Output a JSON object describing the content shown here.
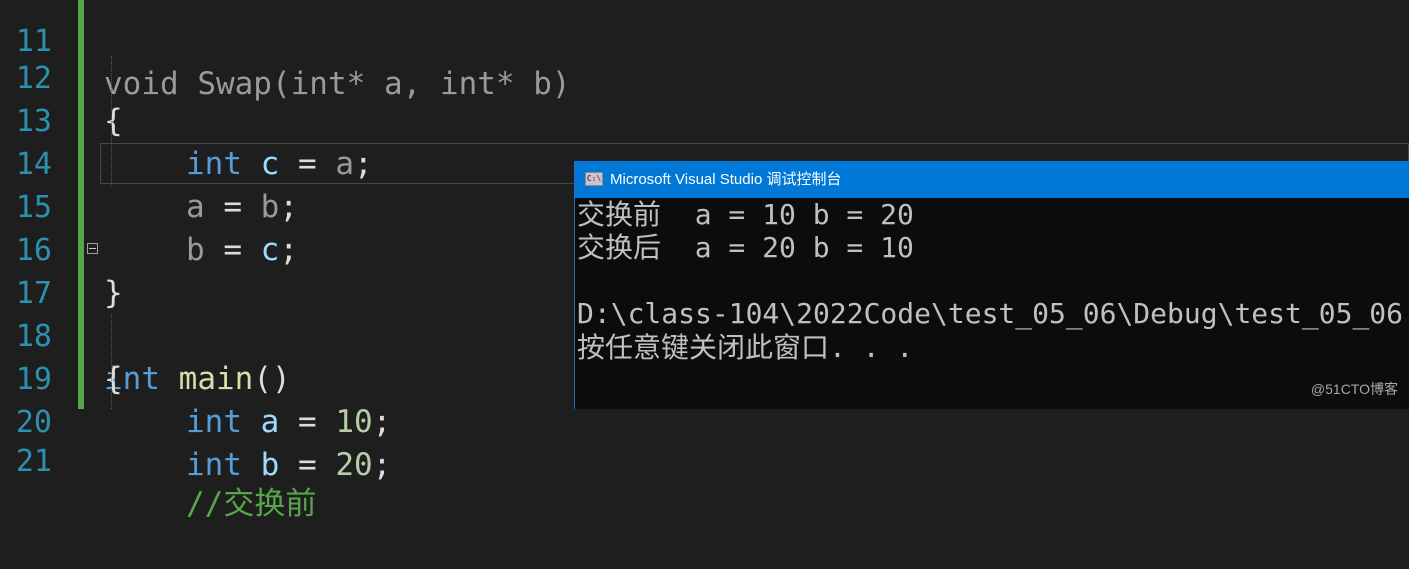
{
  "editor": {
    "lines": [
      {
        "number": "11",
        "text": "void Swap(int* a, int* b)"
      },
      {
        "number": "12",
        "text": "{"
      },
      {
        "number": "13",
        "kw": "int",
        "var": "c",
        "op": " = ",
        "param": "a",
        "end": ";"
      },
      {
        "number": "14",
        "param1": "a",
        "op": " = ",
        "param2": "b",
        "end": ";"
      },
      {
        "number": "15",
        "param1": "b",
        "op": " = ",
        "var": "c",
        "end": ";"
      },
      {
        "number": "16",
        "text": "}"
      },
      {
        "number": "17",
        "kw": "int",
        "fn": "main",
        "end": "()"
      },
      {
        "number": "18",
        "text": "{"
      },
      {
        "number": "19",
        "kw": "int",
        "var": "a",
        "op": " = ",
        "num": "10",
        "end": ";"
      },
      {
        "number": "20",
        "kw": "int",
        "var": "b",
        "op": " = ",
        "num": "20",
        "end": ";"
      },
      {
        "number": "21",
        "text": "//交换前"
      }
    ]
  },
  "console": {
    "title": "Microsoft Visual Studio 调试控制台",
    "icon_label": "C:\\",
    "lines": [
      "交换前  a = 10 b = 20",
      "交换后  a = 20 b = 10",
      "",
      "D:\\class-104\\2022Code\\test_05_06\\Debug\\test_05_06",
      "按任意键关闭此窗口. . ."
    ]
  },
  "watermark": "@51CTO博客",
  "colors": {
    "editor_bg": "#1e1e1e",
    "line_number": "#2b91af",
    "keyword": "#569cd6",
    "variable": "#9cdcfe",
    "number": "#b5cea8",
    "function": "#dcdcaa",
    "change_bar": "#57a64a",
    "console_title_bg": "#0078d7",
    "console_bg": "#0c0c0c"
  }
}
